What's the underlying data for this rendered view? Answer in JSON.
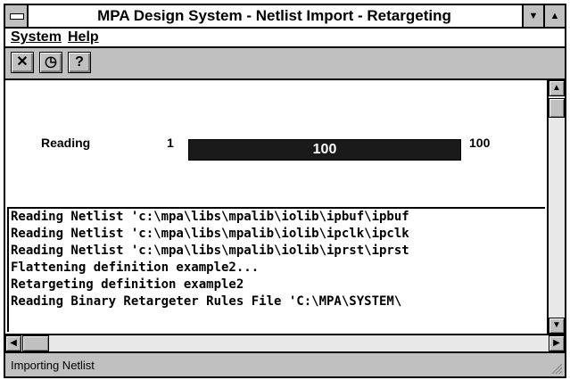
{
  "window": {
    "title": "MPA Design System - Netlist Import - Retargeting"
  },
  "menu": [
    {
      "label": "System"
    },
    {
      "label": "Help"
    }
  ],
  "toolbar": {
    "buttons": [
      {
        "icon": "cancel-icon",
        "glyph": "✕"
      },
      {
        "icon": "clock-icon",
        "glyph": "◷"
      },
      {
        "icon": "help-icon",
        "glyph": "?"
      }
    ]
  },
  "progress": {
    "label": "Reading",
    "min_label": "1",
    "max_label": "100",
    "value_text": "100",
    "fraction": 1.0
  },
  "log": {
    "lines": [
      "Reading Netlist 'c:\\mpa\\libs\\mpalib\\iolib\\ipbuf\\ipbuf",
      "Reading Netlist 'c:\\mpa\\libs\\mpalib\\iolib\\ipclk\\ipclk",
      "Reading Netlist 'c:\\mpa\\libs\\mpalib\\iolib\\iprst\\iprst",
      "Flattening definition example2...",
      "Retargeting definition example2",
      "Reading Binary Retargeter Rules File 'C:\\MPA\\SYSTEM\\"
    ]
  },
  "status": {
    "text": "Importing Netlist"
  },
  "colors": {
    "face": "#c0c0c0",
    "progress_fill": "#1a1a1a"
  }
}
